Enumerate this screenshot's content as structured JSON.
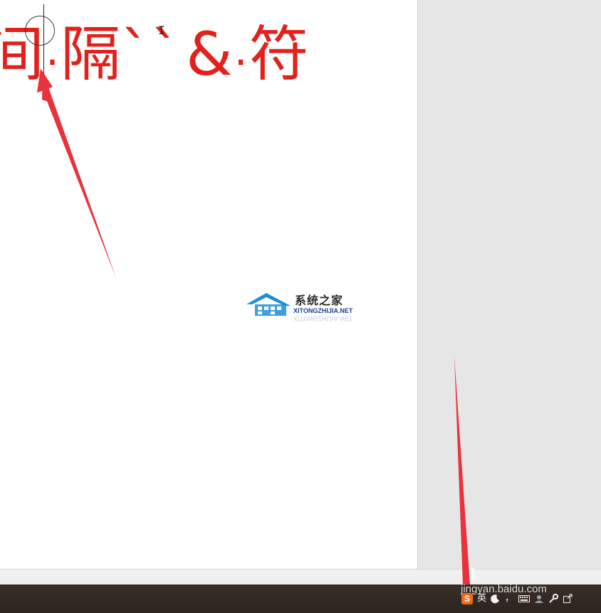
{
  "document": {
    "text_parts": [
      "间",
      "·",
      "隔",
      "`",
      "`",
      "&",
      "·",
      "符"
    ]
  },
  "watermark": {
    "title": "系统之家",
    "url": "XITONGZHIJIA.NET"
  },
  "taskbar": {
    "tray": {
      "ime_logo": "S",
      "ime_mode": "英",
      "punct": "，"
    }
  },
  "baidu": {
    "logo": "B",
    "site": "jingyan.baidu.com"
  },
  "colors": {
    "text_red": "#e2211c",
    "arrow_red": "#e8323c",
    "right_pane": "#e6e6e6",
    "taskbar": "#2f2620"
  }
}
